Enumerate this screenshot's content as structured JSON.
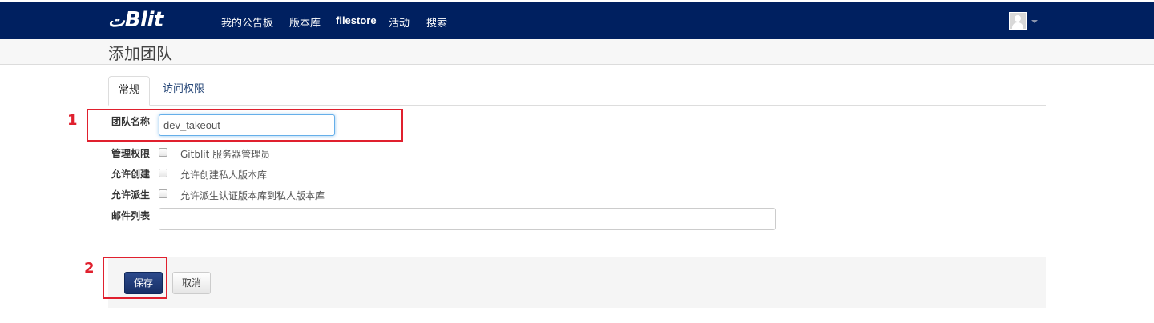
{
  "navbar": {
    "brand": "Blit",
    "brand_prefix": "ت",
    "items": [
      {
        "label": "我的公告板"
      },
      {
        "label": "版本库"
      },
      {
        "label": "filestore"
      },
      {
        "label": "活动"
      },
      {
        "label": "搜索"
      }
    ],
    "colors": {
      "background": "#002060"
    }
  },
  "page": {
    "title": "添加团队"
  },
  "tabs": [
    {
      "label": "常规",
      "active": true
    },
    {
      "label": "访问权限",
      "active": false
    }
  ],
  "form": {
    "team_name": {
      "label": "团队名称",
      "value": "dev_takeout"
    },
    "admin": {
      "label": "管理权限",
      "checked": false,
      "text": "Gitblit 服务器管理员"
    },
    "create": {
      "label": "允许创建",
      "checked": false,
      "text": "允许创建私人版本库"
    },
    "fork": {
      "label": "允许派生",
      "checked": false,
      "text": "允许派生认证版本库到私人版本库"
    },
    "mailing_list": {
      "label": "邮件列表",
      "value": ""
    }
  },
  "actions": {
    "save": "保存",
    "cancel": "取消"
  },
  "annotations": {
    "marker1": "1",
    "marker2": "2",
    "color": "#e0202e"
  }
}
